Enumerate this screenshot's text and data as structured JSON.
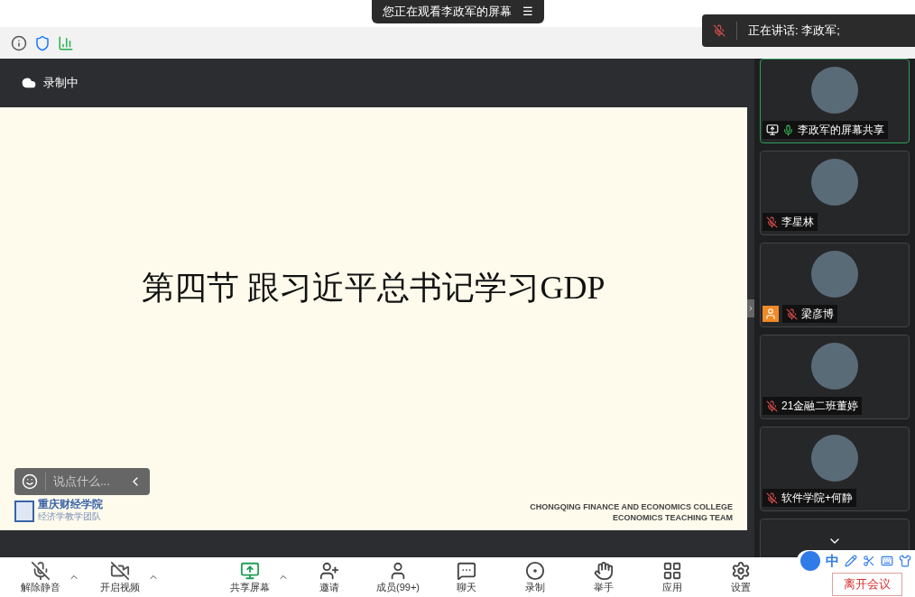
{
  "banner": {
    "text": "您正在观看李政军的屏幕",
    "menu_glyph": "☰"
  },
  "speaking": {
    "text": "正在讲话: 李政军;"
  },
  "recording": {
    "text": "录制中"
  },
  "slide": {
    "title": "第四节 跟习近平总书记学习GDP",
    "logo_name": "重庆财经学院",
    "logo_sub": "经济学教学团队",
    "footer_lines": [
      "CHONGQING FINANCE AND ECONOMICS COLLEGE",
      "ECONOMICS TEACHING TEAM"
    ]
  },
  "chat": {
    "placeholder": "说点什么..."
  },
  "participants": [
    {
      "name": "李政军的屏幕共享",
      "muted": false,
      "sharing": true,
      "no_video": false,
      "selected": true
    },
    {
      "name": "李星林",
      "muted": true,
      "sharing": false,
      "no_video": false,
      "selected": false
    },
    {
      "name": "梁彦博",
      "muted": true,
      "sharing": false,
      "no_video": true,
      "selected": false
    },
    {
      "name": "21金融二班董婷",
      "muted": true,
      "sharing": false,
      "no_video": false,
      "selected": false
    },
    {
      "name": "软件学院+何静",
      "muted": true,
      "sharing": false,
      "no_video": false,
      "selected": false
    }
  ],
  "toolbar": [
    {
      "kind": "mic",
      "label": "解除静音",
      "caret": true
    },
    {
      "kind": "video",
      "label": "开启视频",
      "caret": true
    },
    {
      "kind": "share",
      "label": "共享屏幕",
      "caret": true
    },
    {
      "kind": "invite",
      "label": "邀请",
      "caret": false
    },
    {
      "kind": "members",
      "label": "成员(99+)",
      "caret": false
    },
    {
      "kind": "chat",
      "label": "聊天",
      "caret": false
    },
    {
      "kind": "record",
      "label": "录制",
      "caret": false
    },
    {
      "kind": "hand",
      "label": "举手",
      "caret": false
    },
    {
      "kind": "apps",
      "label": "应用",
      "caret": false
    },
    {
      "kind": "settings",
      "label": "设置",
      "caret": false
    }
  ],
  "leave_button": "离开会议",
  "ime": {
    "mode": "中"
  }
}
